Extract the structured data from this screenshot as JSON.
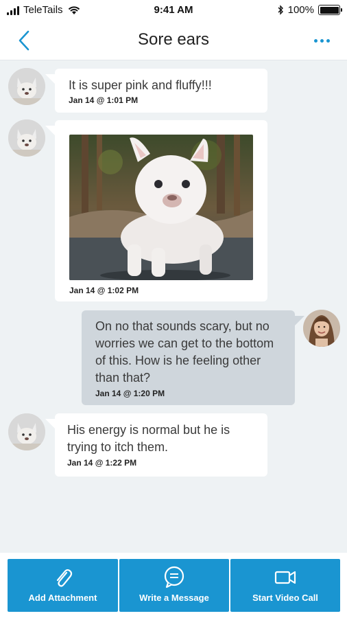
{
  "status_bar": {
    "carrier": "TeleTails",
    "time": "9:41 AM",
    "battery_percent": "100%",
    "battery_level": 1.0
  },
  "header": {
    "title": "Sore ears",
    "back_icon": "chevron-left-icon",
    "menu_icon": "more-horizontal-icon"
  },
  "messages": [
    {
      "direction": "incoming",
      "sender": "pet",
      "text": "It is super pink and fluffy!!!",
      "time": "Jan 14 @ 1:01 PM"
    },
    {
      "direction": "incoming",
      "sender": "pet",
      "type": "image",
      "image": "white-french-bulldog-puppy",
      "time": "Jan 14 @ 1:02 PM"
    },
    {
      "direction": "outgoing",
      "sender": "vet",
      "text": "On no that sounds scary, but no worries we can get to the bottom of this. How is he feeling other than that?",
      "time": "Jan 14 @ 1:20 PM"
    },
    {
      "direction": "incoming",
      "sender": "pet",
      "text": "His energy is normal but he is trying to itch them.",
      "time": "Jan 14 @ 1:22 PM"
    }
  ],
  "actions": [
    {
      "label": "Add Attachment",
      "icon": "paperclip-icon"
    },
    {
      "label": "Write a Message",
      "icon": "chat-bubble-icon"
    },
    {
      "label": "Start Video Call",
      "icon": "video-camera-icon"
    }
  ],
  "colors": {
    "accent": "#1a95d1",
    "chat_background": "#eef2f4",
    "incoming_bubble": "#ffffff",
    "outgoing_bubble": "#cfd6dc"
  }
}
